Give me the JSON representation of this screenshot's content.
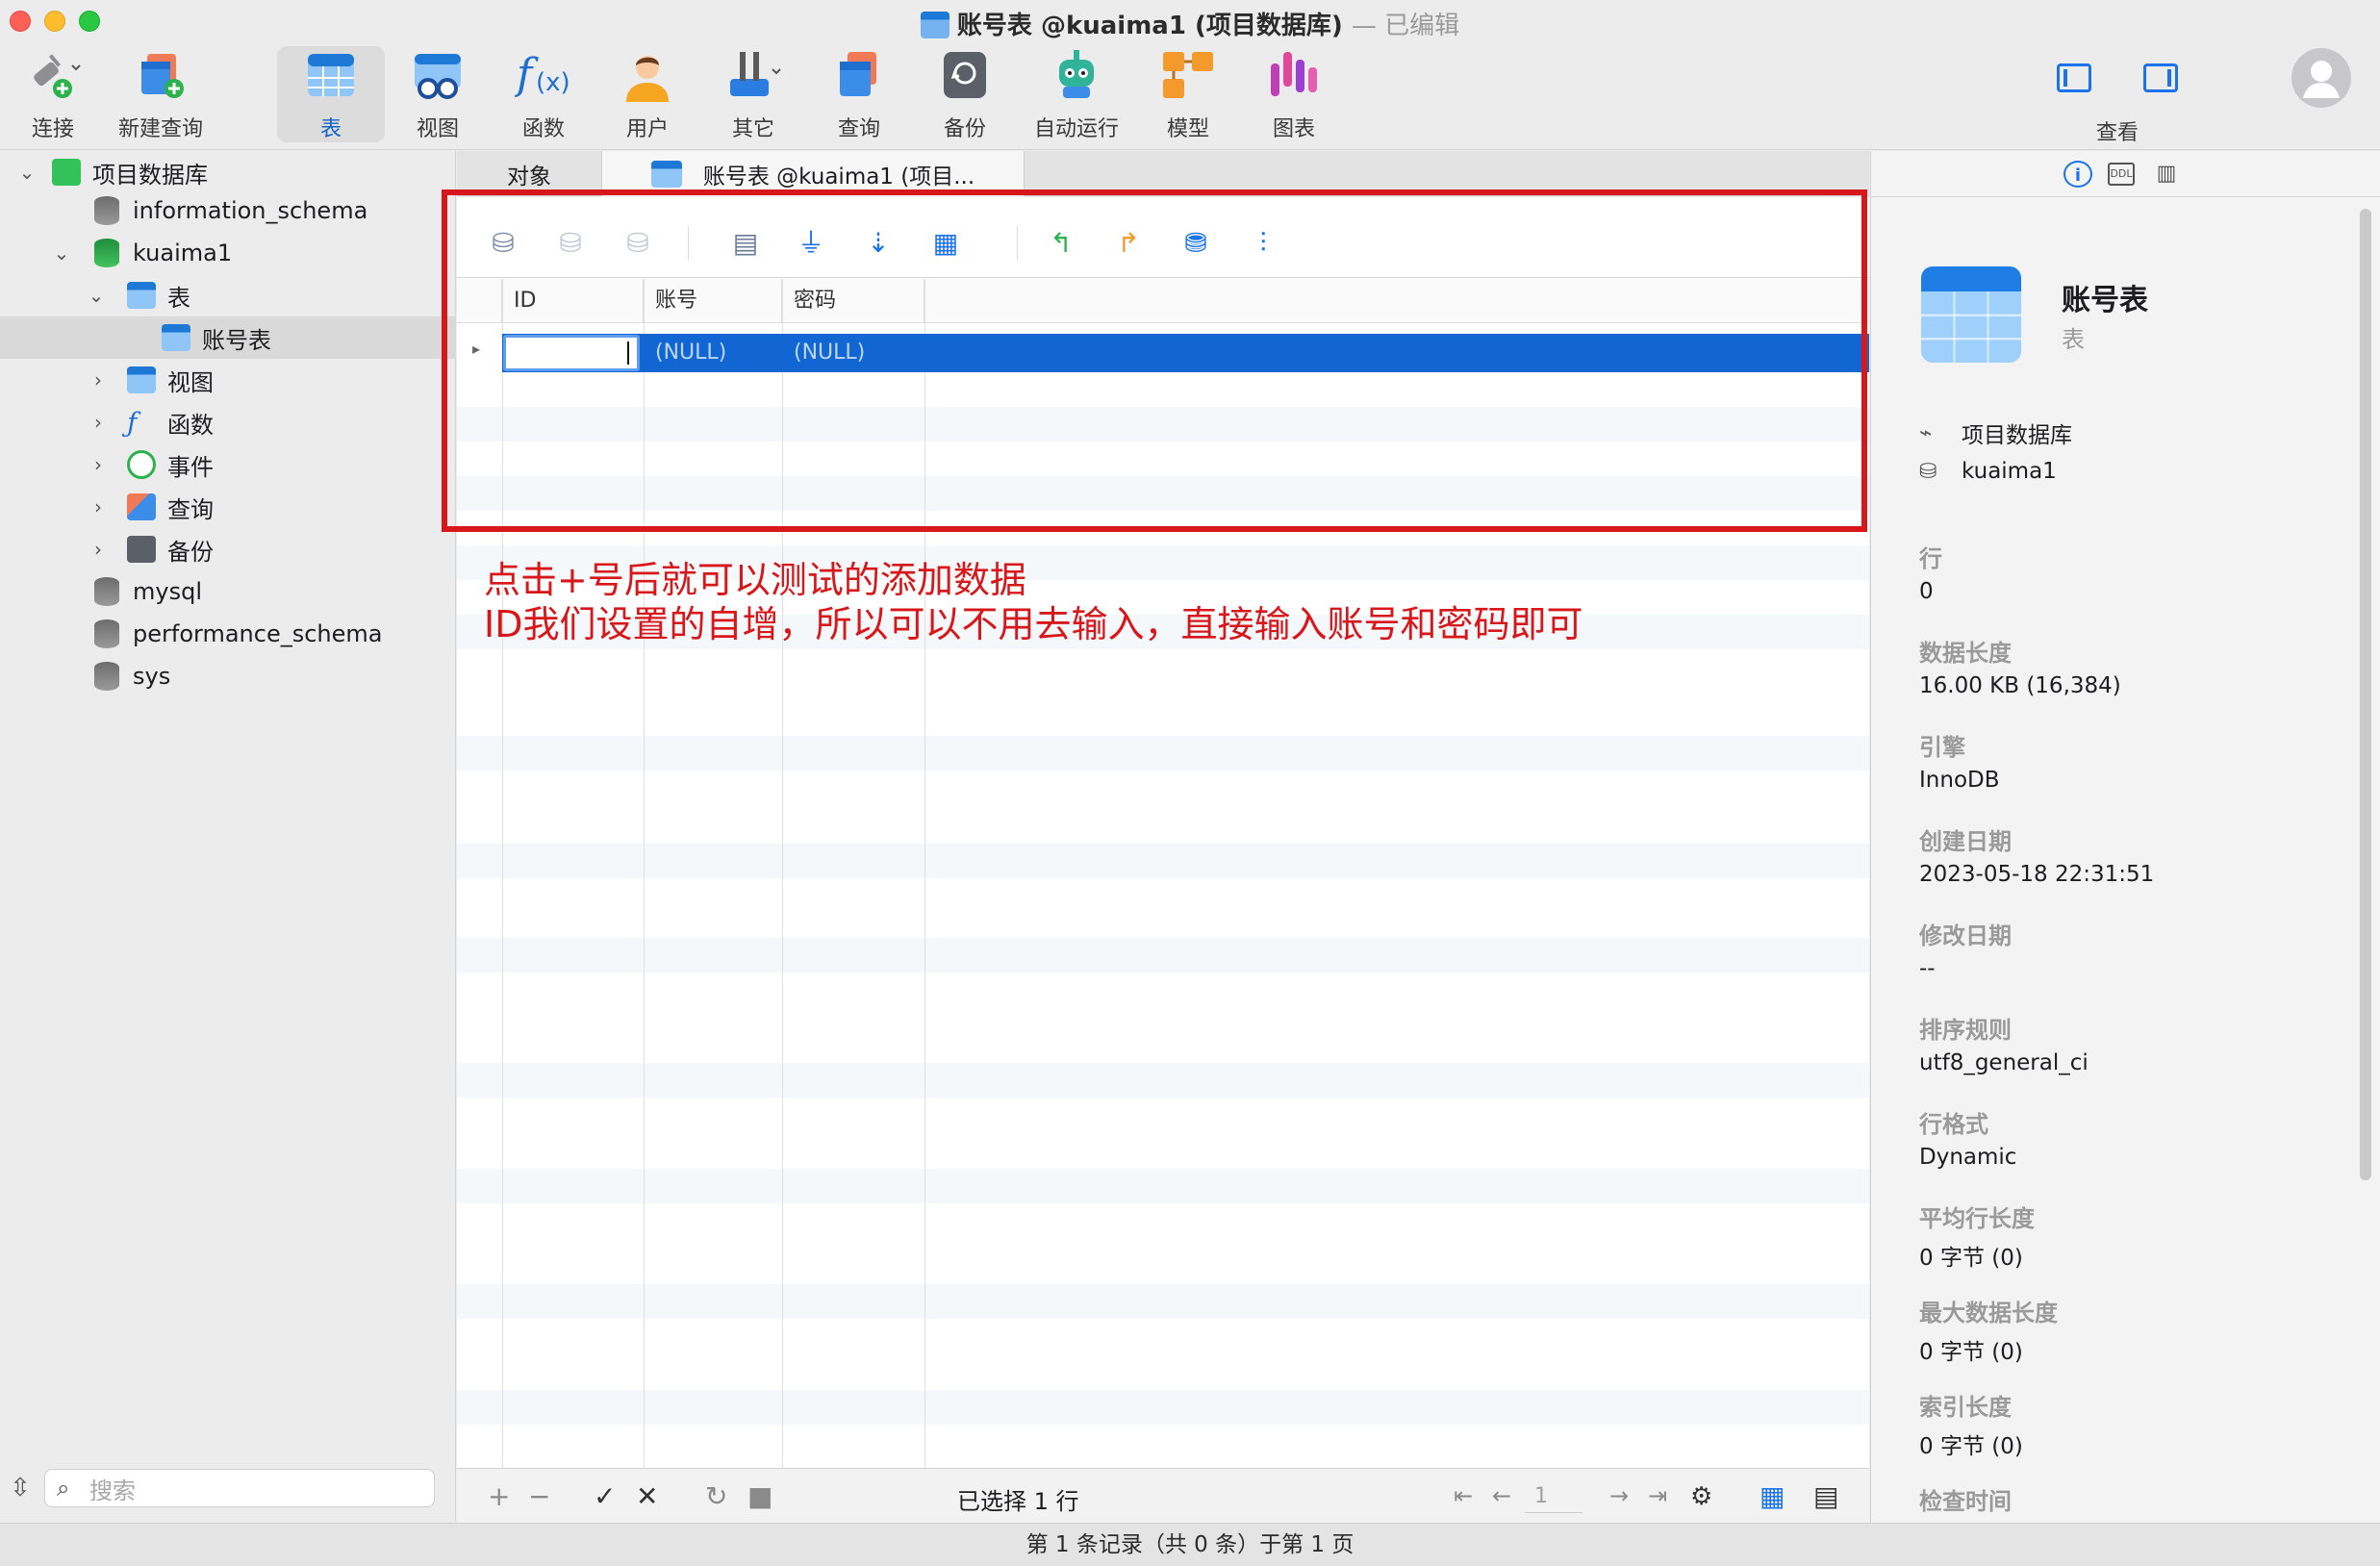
{
  "window": {
    "title": "账号表 @kuaima1 (项目数据库)",
    "edited": "— 已编辑"
  },
  "toolbar": {
    "items": [
      {
        "label": "连接",
        "icon": "plug-icon"
      },
      {
        "label": "新建查询",
        "icon": "new-query-icon"
      },
      {
        "label": "表",
        "icon": "table-icon"
      },
      {
        "label": "视图",
        "icon": "view-icon"
      },
      {
        "label": "函数",
        "icon": "function-icon"
      },
      {
        "label": "用户",
        "icon": "user-icon"
      },
      {
        "label": "其它",
        "icon": "tools-icon"
      },
      {
        "label": "查询",
        "icon": "query-icon"
      },
      {
        "label": "备份",
        "icon": "backup-icon"
      },
      {
        "label": "自动运行",
        "icon": "robot-icon"
      },
      {
        "label": "模型",
        "icon": "model-icon"
      },
      {
        "label": "图表",
        "icon": "chart-icon"
      }
    ],
    "view_label": "查看",
    "accent": "#1464c8"
  },
  "sidebar": {
    "items": [
      {
        "label": "项目数据库"
      },
      {
        "label": "information_schema"
      },
      {
        "label": "kuaima1"
      },
      {
        "label": "表"
      },
      {
        "label": "账号表"
      },
      {
        "label": "视图"
      },
      {
        "label": "函数"
      },
      {
        "label": "事件"
      },
      {
        "label": "查询"
      },
      {
        "label": "备份"
      },
      {
        "label": "mysql"
      },
      {
        "label": "performance_schema"
      },
      {
        "label": "sys"
      }
    ],
    "search_placeholder": "搜索"
  },
  "tabs": [
    {
      "label": "对象"
    },
    {
      "label": "账号表 @kuaima1 (项目..."
    }
  ],
  "grid": {
    "columns": [
      "ID",
      "账号",
      "密码"
    ],
    "rows": [
      {
        "id": "",
        "account": "(NULL)",
        "password": "(NULL)"
      }
    ],
    "selection_color": "#1266d4"
  },
  "annotation": {
    "line1": "点击+号后就可以测试的添加数据",
    "line2": "ID我们设置的自增，所以可以不用去输入，直接输入账号和密码即可",
    "color": "#d8171a"
  },
  "bottom": {
    "selected_text": "已选择 1 行",
    "page_value": "1"
  },
  "status": {
    "text": "第 1 条记录（共 0 条）于第 1 页"
  },
  "info_panel": {
    "table_name": "账号表",
    "table_kind": "表",
    "connection": "项目数据库",
    "database": "kuaima1",
    "properties": [
      {
        "key": "行",
        "value": "0"
      },
      {
        "key": "数据长度",
        "value": "16.00 KB (16,384)"
      },
      {
        "key": "引擎",
        "value": "InnoDB"
      },
      {
        "key": "创建日期",
        "value": "2023-05-18 22:31:51"
      },
      {
        "key": "修改日期",
        "value": "--"
      },
      {
        "key": "排序规则",
        "value": "utf8_general_ci"
      },
      {
        "key": "行格式",
        "value": "Dynamic"
      },
      {
        "key": "平均行长度",
        "value": "0 字节 (0)"
      },
      {
        "key": "最大数据长度",
        "value": "0 字节 (0)"
      },
      {
        "key": "索引长度",
        "value": "0 字节 (0)"
      },
      {
        "key": "检查时间",
        "value": ""
      }
    ]
  }
}
